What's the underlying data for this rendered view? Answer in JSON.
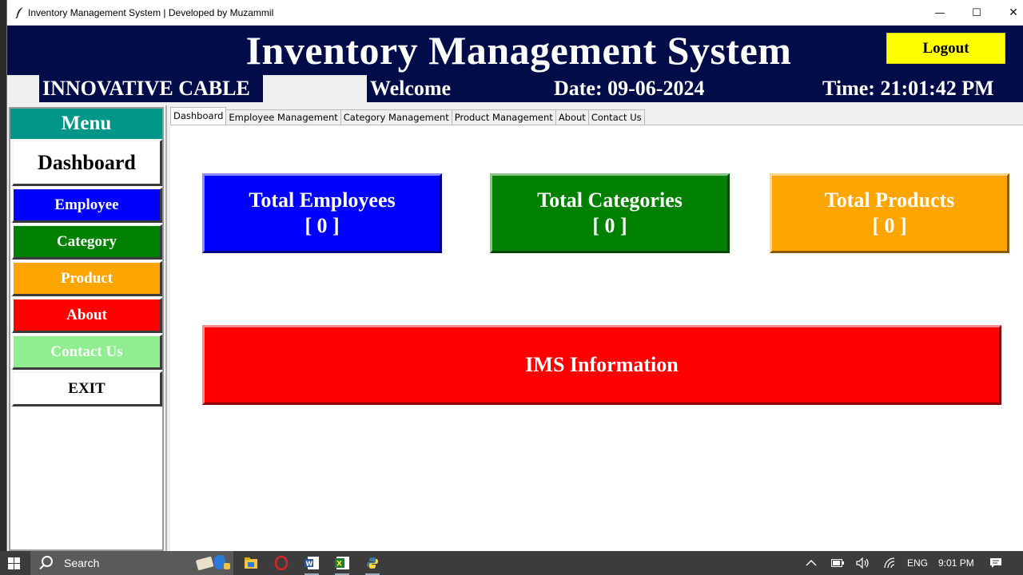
{
  "window": {
    "title": "Inventory Management System | Developed by Muzammil",
    "minimize": "—",
    "maximize": "☐",
    "close": "✕"
  },
  "header": {
    "app_title": "Inventory Management System",
    "logout_label": "Logout",
    "company": "INNOVATIVE CABLE",
    "welcome": "Welcome",
    "date": "Date: 09-06-2024",
    "time": "Time: 21:01:42 PM"
  },
  "sidebar": {
    "title": "Menu",
    "items": [
      {
        "label": "Dashboard",
        "color": "#ffffff"
      },
      {
        "label": "Employee",
        "color": "#0000ff"
      },
      {
        "label": "Category",
        "color": "#008000"
      },
      {
        "label": "Product",
        "color": "#ffa500"
      },
      {
        "label": "About",
        "color": "#ff0000"
      },
      {
        "label": "Contact Us",
        "color": "#90ee90"
      },
      {
        "label": "EXIT",
        "color": "#ffffff"
      }
    ]
  },
  "tabs": [
    {
      "label": "Dashboard",
      "active": true
    },
    {
      "label": "Employee Management",
      "active": false
    },
    {
      "label": "Category Management",
      "active": false
    },
    {
      "label": "Product Management",
      "active": false
    },
    {
      "label": "About",
      "active": false
    },
    {
      "label": "Contact Us",
      "active": false
    }
  ],
  "dashboard": {
    "cards": [
      {
        "title": "Total Employees",
        "value": "[ 0 ]",
        "color": "#0000ff"
      },
      {
        "title": "Total Categories",
        "value": "[ 0 ]",
        "color": "#008000"
      },
      {
        "title": "Total Products",
        "value": "[ 0 ]",
        "color": "#ffa500"
      }
    ],
    "info_label": "IMS Information",
    "info_color": "#ff0000"
  },
  "taskbar": {
    "search_label": "Search",
    "apps": [
      "file-explorer-icon",
      "opera-icon",
      "word-icon",
      "excel-icon",
      "python-icon"
    ],
    "tray": {
      "language": "ENG",
      "clock": "9:01 PM"
    }
  },
  "colors": {
    "header_bg": "#010c48",
    "logout_bg": "#ffff00",
    "menu_title_bg": "#009688"
  }
}
